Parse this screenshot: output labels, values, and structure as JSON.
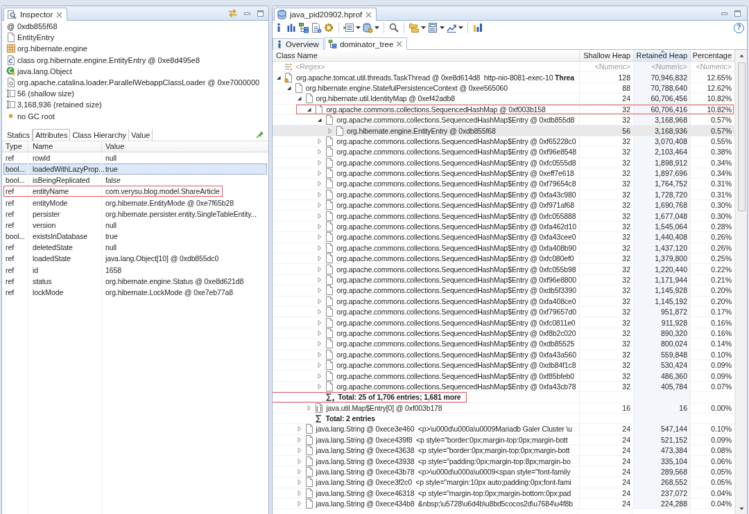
{
  "inspector": {
    "title": "Inspector",
    "info": [
      {
        "kind": "address",
        "symbol": "@",
        "text": "0xdb855f68"
      },
      {
        "kind": "class_name",
        "text": "EntityEntry"
      },
      {
        "kind": "package",
        "text": "org.hibernate.engine"
      },
      {
        "kind": "class",
        "text": "class org.hibernate.engine.EntityEntry @ 0xe8d495e8"
      },
      {
        "kind": "superclass",
        "text": "java.lang.Object"
      },
      {
        "kind": "class_loader",
        "text": "org.apache.catalina.loader.ParallelWebappClassLoader @ 0xe7000000"
      },
      {
        "kind": "shallow_size",
        "text": "56 (shallow size)"
      },
      {
        "kind": "retained_size",
        "text": "3,168,936 (retained size)"
      },
      {
        "kind": "gc_root",
        "text": "no GC root"
      }
    ],
    "tabs": [
      {
        "label": "Statics",
        "selected": false
      },
      {
        "label": "Attributes",
        "selected": true
      },
      {
        "label": "Class Hierarchy",
        "selected": false
      },
      {
        "label": "Value",
        "selected": false
      }
    ],
    "attributes": {
      "columns": [
        "Type",
        "Name",
        "Value"
      ],
      "rows": [
        {
          "type": "ref",
          "name": "rowId",
          "value": "null",
          "selected": false,
          "annotated": false
        },
        {
          "type": "bool...",
          "name": "loadedWithLazyProp...",
          "value": "true",
          "selected": true,
          "annotated": false
        },
        {
          "type": "bool...",
          "name": "isBeingReplicated",
          "value": "false",
          "selected": false,
          "annotated": false
        },
        {
          "type": "ref",
          "name": "entityName",
          "value": "com.verysu.blog.model.ShareArticle",
          "selected": false,
          "annotated": true
        },
        {
          "type": "ref",
          "name": "entityMode",
          "value": "org.hibernate.EntityMode @ 0xe7f65b28",
          "selected": false,
          "annotated": false
        },
        {
          "type": "ref",
          "name": "persister",
          "value": "org.hibernate.persister.entity.SingleTableEntity...",
          "selected": false,
          "annotated": false
        },
        {
          "type": "ref",
          "name": "version",
          "value": "null",
          "selected": false,
          "annotated": false
        },
        {
          "type": "bool...",
          "name": "existsInDatabase",
          "value": "true",
          "selected": false,
          "annotated": false
        },
        {
          "type": "ref",
          "name": "deletedState",
          "value": "null",
          "selected": false,
          "annotated": false
        },
        {
          "type": "ref",
          "name": "loadedState",
          "value": "java.lang.Object[10] @ 0xdb855dc0",
          "selected": false,
          "annotated": false
        },
        {
          "type": "ref",
          "name": "id",
          "value": "1658",
          "selected": false,
          "annotated": false
        },
        {
          "type": "ref",
          "name": "status",
          "value": "org.hibernate.engine.Status @ 0xe8d621d8",
          "selected": false,
          "annotated": false
        },
        {
          "type": "ref",
          "name": "lockMode",
          "value": "org.hibernate.LockMode @ 0xe7eb77a8",
          "selected": false,
          "annotated": false
        }
      ]
    }
  },
  "editor": {
    "title": "java_pid20902.hprof",
    "help": "?",
    "tabs": [
      {
        "label": "Overview",
        "kind": "overview",
        "selected": false
      },
      {
        "label": "dominator_tree",
        "kind": "tree",
        "selected": true
      }
    ],
    "table": {
      "columns": [
        {
          "label": "Class Name",
          "sorted": false
        },
        {
          "label": "Shallow Heap",
          "sorted": false
        },
        {
          "label": "Retained Heap",
          "sorted": true
        },
        {
          "label": "Percentage",
          "sorted": false
        }
      ],
      "filters": [
        {
          "placeholder": "<Regex>"
        },
        {
          "placeholder": "<Numeric>"
        },
        {
          "placeholder": "<Numeric>"
        },
        {
          "placeholder": "<Numeric>"
        }
      ],
      "rows": [
        {
          "kind": "thread",
          "name": "org.apache.tomcat.util.threads.TaskThread @ 0xe8d614d8  http-nio-8081-exec-10 **Threa**",
          "shallow_heap": "128",
          "retained_heap": "70,946,832",
          "percentage": "12.65%",
          "expanded": true,
          "selected": false,
          "annotated": false,
          "children": [
            {
              "kind": "object",
              "name": "org.hibernate.engine.StatefulPersistenceContext @ 0xee565060",
              "shallow_heap": "88",
              "retained_heap": "70,788,640",
              "percentage": "12.62%",
              "expanded": true,
              "selected": false,
              "annotated": false,
              "children": [
                {
                  "kind": "object",
                  "name": "org.hibernate.util.IdentityMap @ 0xef42adb8",
                  "shallow_heap": "24",
                  "retained_heap": "60,706,456",
                  "percentage": "10.82%",
                  "expanded": true,
                  "selected": false,
                  "annotated": false,
                  "children": [
                    {
                      "kind": "object",
                      "name": "org.apache.commons.collections.SequencedHashMap @ 0xf003b158",
                      "shallow_heap": "32",
                      "retained_heap": "60,706,416",
                      "percentage": "10.82%",
                      "expanded": true,
                      "selected": false,
                      "annotated": true,
                      "children": [
                        {
                          "kind": "object",
                          "name": "org.apache.commons.collections.SequencedHashMap$Entry @ 0xdb855d8",
                          "shallow_heap": "32",
                          "retained_heap": "3,168,968",
                          "percentage": "0.57%",
                          "expanded": true,
                          "selected": false,
                          "annotated": false,
                          "children": [
                            {
                              "kind": "object",
                              "name": "org.hibernate.engine.EntityEntry @ 0xdb855f68",
                              "shallow_heap": "56",
                              "retained_heap": "3,168,936",
                              "percentage": "0.57%",
                              "expanded": false,
                              "selected": true,
                              "annotated": false
                            }
                          ]
                        },
                        {
                          "kind": "object",
                          "name": "org.apache.commons.collections.SequencedHashMap$Entry @ 0xf65228c0",
                          "shallow_heap": "32",
                          "retained_heap": "3,070,408",
                          "percentage": "0.55%",
                          "expanded": false,
                          "selected": false,
                          "annotated": false
                        },
                        {
                          "kind": "object",
                          "name": "org.apache.commons.collections.SequencedHashMap$Entry @ 0xf96e8548",
                          "shallow_heap": "32",
                          "retained_heap": "2,103,464",
                          "percentage": "0.38%",
                          "expanded": false,
                          "selected": false,
                          "annotated": false
                        },
                        {
                          "kind": "object",
                          "name": "org.apache.commons.collections.SequencedHashMap$Entry @ 0xfc0555d8",
                          "shallow_heap": "32",
                          "retained_heap": "1,898,912",
                          "percentage": "0.34%",
                          "expanded": false,
                          "selected": false,
                          "annotated": false
                        },
                        {
                          "kind": "object",
                          "name": "org.apache.commons.collections.SequencedHashMap$Entry @ 0xeff7e618",
                          "shallow_heap": "32",
                          "retained_heap": "1,897,696",
                          "percentage": "0.34%",
                          "expanded": false,
                          "selected": false,
                          "annotated": false
                        },
                        {
                          "kind": "object",
                          "name": "org.apache.commons.collections.SequencedHashMap$Entry @ 0xf79654c8",
                          "shallow_heap": "32",
                          "retained_heap": "1,764,752",
                          "percentage": "0.31%",
                          "expanded": false,
                          "selected": false,
                          "annotated": false
                        },
                        {
                          "kind": "object",
                          "name": "org.apache.commons.collections.SequencedHashMap$Entry @ 0xfa43c980",
                          "shallow_heap": "32",
                          "retained_heap": "1,728,720",
                          "percentage": "0.31%",
                          "expanded": false,
                          "selected": false,
                          "annotated": false
                        },
                        {
                          "kind": "object",
                          "name": "org.apache.commons.collections.SequencedHashMap$Entry @ 0xf971af68",
                          "shallow_heap": "32",
                          "retained_heap": "1,690,768",
                          "percentage": "0.30%",
                          "expanded": false,
                          "selected": false,
                          "annotated": false
                        },
                        {
                          "kind": "object",
                          "name": "org.apache.commons.collections.SequencedHashMap$Entry @ 0xfc055888",
                          "shallow_heap": "32",
                          "retained_heap": "1,677,048",
                          "percentage": "0.30%",
                          "expanded": false,
                          "selected": false,
                          "annotated": false
                        },
                        {
                          "kind": "object",
                          "name": "org.apache.commons.collections.SequencedHashMap$Entry @ 0xfa462d10",
                          "shallow_heap": "32",
                          "retained_heap": "1,545,064",
                          "percentage": "0.28%",
                          "expanded": false,
                          "selected": false,
                          "annotated": false
                        },
                        {
                          "kind": "object",
                          "name": "org.apache.commons.collections.SequencedHashMap$Entry @ 0xfa43cee0",
                          "shallow_heap": "32",
                          "retained_heap": "1,440,408",
                          "percentage": "0.26%",
                          "expanded": false,
                          "selected": false,
                          "annotated": false
                        },
                        {
                          "kind": "object",
                          "name": "org.apache.commons.collections.SequencedHashMap$Entry @ 0xfa408b90",
                          "shallow_heap": "32",
                          "retained_heap": "1,437,120",
                          "percentage": "0.26%",
                          "expanded": false,
                          "selected": false,
                          "annotated": false
                        },
                        {
                          "kind": "object",
                          "name": "org.apache.commons.collections.SequencedHashMap$Entry @ 0xfc080ef0",
                          "shallow_heap": "32",
                          "retained_heap": "1,379,800",
                          "percentage": "0.25%",
                          "expanded": false,
                          "selected": false,
                          "annotated": false
                        },
                        {
                          "kind": "object",
                          "name": "org.apache.commons.collections.SequencedHashMap$Entry @ 0xfc055b98",
                          "shallow_heap": "32",
                          "retained_heap": "1,220,440",
                          "percentage": "0.22%",
                          "expanded": false,
                          "selected": false,
                          "annotated": false
                        },
                        {
                          "kind": "object",
                          "name": "org.apache.commons.collections.SequencedHashMap$Entry @ 0xf96e8800",
                          "shallow_heap": "32",
                          "retained_heap": "1,171,944",
                          "percentage": "0.21%",
                          "expanded": false,
                          "selected": false,
                          "annotated": false
                        },
                        {
                          "kind": "object",
                          "name": "org.apache.commons.collections.SequencedHashMap$Entry @ 0xdb5f3390",
                          "shallow_heap": "32",
                          "retained_heap": "1,145,928",
                          "percentage": "0.20%",
                          "expanded": false,
                          "selected": false,
                          "annotated": false
                        },
                        {
                          "kind": "object",
                          "name": "org.apache.commons.collections.SequencedHashMap$Entry @ 0xfa408ce0",
                          "shallow_heap": "32",
                          "retained_heap": "1,145,192",
                          "percentage": "0.20%",
                          "expanded": false,
                          "selected": false,
                          "annotated": false
                        },
                        {
                          "kind": "object",
                          "name": "org.apache.commons.collections.SequencedHashMap$Entry @ 0xf79657d0",
                          "shallow_heap": "32",
                          "retained_heap": "951,872",
                          "percentage": "0.17%",
                          "expanded": false,
                          "selected": false,
                          "annotated": false
                        },
                        {
                          "kind": "object",
                          "name": "org.apache.commons.collections.SequencedHashMap$Entry @ 0xfc0811e0",
                          "shallow_heap": "32",
                          "retained_heap": "911,928",
                          "percentage": "0.16%",
                          "expanded": false,
                          "selected": false,
                          "annotated": false
                        },
                        {
                          "kind": "object",
                          "name": "org.apache.commons.collections.SequencedHashMap$Entry @ 0xf8b2c020",
                          "shallow_heap": "32",
                          "retained_heap": "890,320",
                          "percentage": "0.16%",
                          "expanded": false,
                          "selected": false,
                          "annotated": false
                        },
                        {
                          "kind": "object",
                          "name": "org.apache.commons.collections.SequencedHashMap$Entry @ 0xdb85525",
                          "shallow_heap": "32",
                          "retained_heap": "800,024",
                          "percentage": "0.14%",
                          "expanded": false,
                          "selected": false,
                          "annotated": false
                        },
                        {
                          "kind": "object",
                          "name": "org.apache.commons.collections.SequencedHashMap$Entry @ 0xfa43a560",
                          "shallow_heap": "32",
                          "retained_heap": "559,848",
                          "percentage": "0.10%",
                          "expanded": false,
                          "selected": false,
                          "annotated": false
                        },
                        {
                          "kind": "object",
                          "name": "org.apache.commons.collections.SequencedHashMap$Entry @ 0xdb84f1c8",
                          "shallow_heap": "32",
                          "retained_heap": "530,424",
                          "percentage": "0.09%",
                          "expanded": false,
                          "selected": false,
                          "annotated": false
                        },
                        {
                          "kind": "object",
                          "name": "org.apache.commons.collections.SequencedHashMap$Entry @ 0xf85bfeb0",
                          "shallow_heap": "32",
                          "retained_heap": "486,360",
                          "percentage": "0.09%",
                          "expanded": false,
                          "selected": false,
                          "annotated": false
                        },
                        {
                          "kind": "object",
                          "name": "org.apache.commons.collections.SequencedHashMap$Entry @ 0xfa43cb78",
                          "shallow_heap": "32",
                          "retained_heap": "405,784",
                          "percentage": "0.07%",
                          "expanded": false,
                          "selected": false,
                          "annotated": false
                        },
                        {
                          "kind": "total",
                          "label": "Total: 25 of 1,706 entries; 1,681 more",
                          "more": true,
                          "selected": false,
                          "annotated": true
                        }
                      ]
                    },
                    {
                      "kind": "array",
                      "name": "java.util.Map$Entry[0] @ 0xf003b178",
                      "shallow_heap": "16",
                      "retained_heap": "16",
                      "percentage": "0.00%",
                      "expanded": false,
                      "selected": false,
                      "annotated": false
                    },
                    {
                      "kind": "total",
                      "label": "Total: 2 entries",
                      "more": false,
                      "selected": false,
                      "annotated": false
                    }
                  ]
                },
                {
                  "kind": "object",
                  "name": "java.lang.String @ 0xece3e460  <p>\\u000d\\u000a\\u0009Mariadb Galer Cluster \\u",
                  "shallow_heap": "24",
                  "retained_heap": "547,144",
                  "percentage": "0.10%",
                  "expanded": false,
                  "selected": false,
                  "annotated": false
                },
                {
                  "kind": "object",
                  "name": "java.lang.String @ 0xece439f8  <p style=\"border:0px;margin-top:0px;margin-bott",
                  "shallow_heap": "24",
                  "retained_heap": "521,152",
                  "percentage": "0.09%",
                  "expanded": false,
                  "selected": false,
                  "annotated": false
                },
                {
                  "kind": "object",
                  "name": "java.lang.String @ 0xece43638  <p style=\"border:0px;margin-top:0px;margin-bott",
                  "shallow_heap": "24",
                  "retained_heap": "473,384",
                  "percentage": "0.08%",
                  "expanded": false,
                  "selected": false,
                  "annotated": false
                },
                {
                  "kind": "object",
                  "name": "java.lang.String @ 0xece43938  <p style=\"padding:0px;margin-top:8px;margin-bo",
                  "shallow_heap": "24",
                  "retained_heap": "335,104",
                  "percentage": "0.06%",
                  "expanded": false,
                  "selected": false,
                  "annotated": false
                },
                {
                  "kind": "object",
                  "name": "java.lang.String @ 0xece43b78  <p>\\u000d\\u000a\\u0009<span style=\"font-family",
                  "shallow_heap": "24",
                  "retained_heap": "289,568",
                  "percentage": "0.05%",
                  "expanded": false,
                  "selected": false,
                  "annotated": false
                },
                {
                  "kind": "object",
                  "name": "java.lang.String @ 0xece3f2c0  <p style=\"margin:10px auto;padding:0px;font-fami",
                  "shallow_heap": "24",
                  "retained_heap": "268,552",
                  "percentage": "0.05%",
                  "expanded": false,
                  "selected": false,
                  "annotated": false
                },
                {
                  "kind": "object",
                  "name": "java.lang.String @ 0xece46318  <p style=\"margin-top:0px;margin-bottom:0px;pad",
                  "shallow_heap": "24",
                  "retained_heap": "237,072",
                  "percentage": "0.04%",
                  "expanded": false,
                  "selected": false,
                  "annotated": false
                },
                {
                  "kind": "object",
                  "name": "java.lang.String @ 0xece434b8  &nbsp;\\u5728\\u6d4b\\u8bd5cocos2d\\u7684\\u4f8b",
                  "shallow_heap": "24",
                  "retained_heap": "224,288",
                  "percentage": "0.04%",
                  "expanded": false,
                  "selected": false,
                  "annotated": false
                }
              ]
            }
          ]
        }
      ]
    }
  }
}
